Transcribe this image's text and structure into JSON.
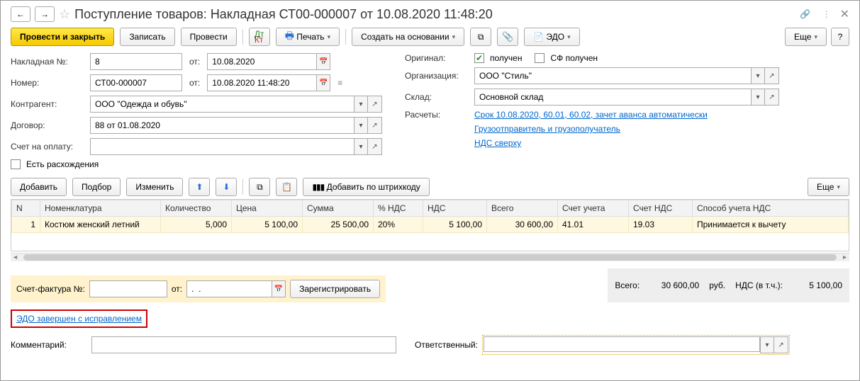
{
  "header": {
    "title": "Поступление товаров: Накладная СТ00-000007 от 10.08.2020 11:48:20"
  },
  "toolbar": {
    "post_close": "Провести и закрыть",
    "save": "Записать",
    "post": "Провести",
    "print": "Печать",
    "create_based": "Создать на основании",
    "edo": "ЭДО",
    "more": "Еще",
    "help": "?"
  },
  "form": {
    "invoice_no_label": "Накладная №:",
    "invoice_no": "8",
    "invoice_from": "от:",
    "invoice_date": "10.08.2020",
    "number_label": "Номер:",
    "number": "СТ00-000007",
    "number_date": "10.08.2020 11:48:20",
    "counterparty_label": "Контрагент:",
    "counterparty": "ООО \"Одежда и обувь\"",
    "contract_label": "Договор:",
    "contract": "88 от 01.08.2020",
    "payinvoice_label": "Счет на оплату:",
    "payinvoice": "",
    "discrepancy_label": "Есть расхождения",
    "original_label": "Оригинал:",
    "received_label": "получен",
    "sf_received_label": "СФ получен",
    "org_label": "Организация:",
    "org": "ООО \"Стиль\"",
    "warehouse_label": "Склад:",
    "warehouse": "Основной склад",
    "calc_label": "Расчеты:",
    "calc_link": "Срок 10.08.2020, 60.01, 60.02, зачет аванса автоматически",
    "shipper_link": "Грузоотправитель и грузополучатель",
    "vat_link": "НДС сверху"
  },
  "table_toolbar": {
    "add": "Добавить",
    "pick": "Подбор",
    "edit": "Изменить",
    "barcode_add": "Добавить по штрихкоду",
    "more": "Еще"
  },
  "table": {
    "headers": {
      "n": "N",
      "nom": "Номенклатура",
      "qty": "Количество",
      "price": "Цена",
      "sum": "Сумма",
      "vat_pct": "% НДС",
      "vat": "НДС",
      "total": "Всего",
      "acc": "Счет учета",
      "vat_acc": "Счет НДС",
      "vat_mode": "Способ учета НДС"
    },
    "rows": [
      {
        "n": "1",
        "nom": "Костюм женский летний",
        "qty": "5,000",
        "price": "5 100,00",
        "sum": "25 500,00",
        "vat_pct": "20%",
        "vat": "5 100,00",
        "total": "30 600,00",
        "acc": "41.01",
        "vat_acc": "19.03",
        "vat_mode": "Принимается к вычету"
      }
    ]
  },
  "sf": {
    "label": "Счет-фактура №:",
    "no": "",
    "from": "от:",
    "date": ".  .",
    "register": "Зарегистрировать"
  },
  "totals": {
    "total_label": "Всего:",
    "total": "30 600,00",
    "currency": "руб.",
    "vat_label": "НДС (в т.ч.):",
    "vat": "5 100,00"
  },
  "edo_status": "ЭДО завершен с исправлением",
  "bottom": {
    "comment_label": "Комментарий:",
    "comment": "",
    "responsible_label": "Ответственный:",
    "responsible": ""
  }
}
